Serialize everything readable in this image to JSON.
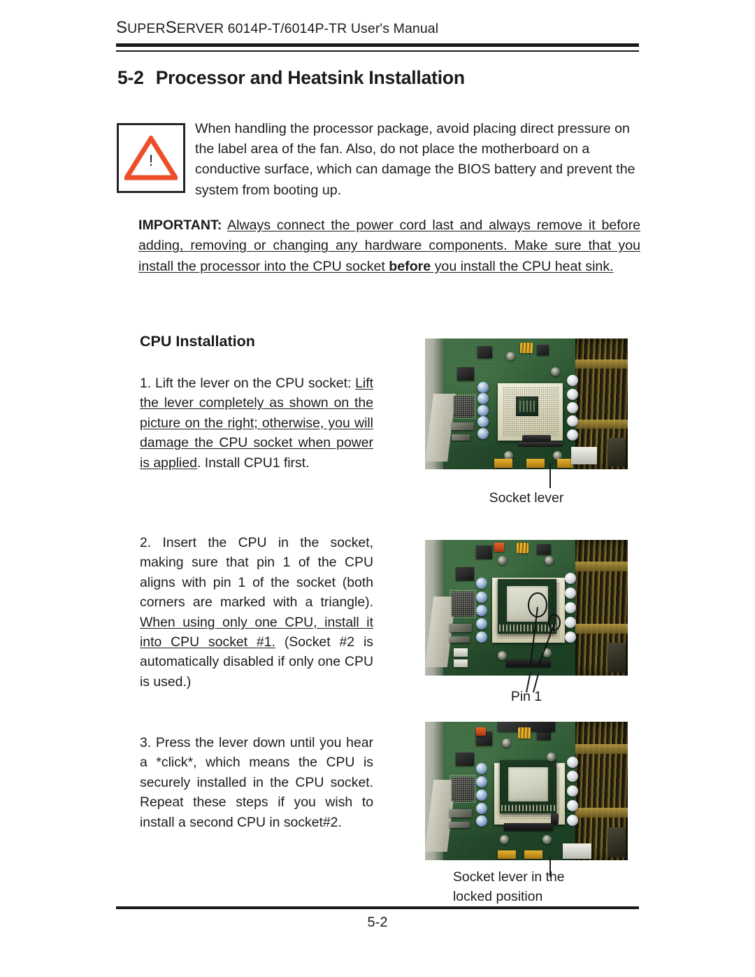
{
  "header": {
    "running_head_prefix": "S",
    "running_head": "SUPERSERVER 6014P-T/6014P-TR User's Manual",
    "running_head_parts": {
      "s1": "S",
      "uper": "UPER",
      "s2": "S",
      "erver": "ERVER",
      "rest": " 6014P-T/6014P-TR User's Manual"
    }
  },
  "section": {
    "number": "5-2",
    "title": "Processor and Heatsink Installation"
  },
  "warning": {
    "icon": "warning-triangle-icon",
    "bang": "!",
    "triangle_color": "#ED4E2A",
    "text": "When handling the processor package, avoid placing direct pressure on the label area of the fan.  Also, do not place the motherboard on a conductive surface, which can damage the BIOS battery and prevent the system from booting up."
  },
  "important": {
    "label": "IMPORTANT:",
    "underlined_text": "Always connect the power cord last and always remove it before adding, removing or changing any hardware components.  Make sure that you install the processor into the CPU socket ",
    "bold_word": "before",
    "tail_text": " you install the CPU heat sink."
  },
  "subsection": {
    "heading": "CPU Installation"
  },
  "steps": [
    {
      "number": "1.",
      "plain_lead": "1. Lift the lever on the CPU socket: ",
      "underlined": "Lift the lever completely as shown on the picture on the right; otherwise,  you will damage the CPU socket when power is applied",
      "tail": ".  Install CPU1 first."
    },
    {
      "number": "2.",
      "plain_lead": "2. Insert the CPU in the socket, making sure that pin 1 of the CPU aligns with pin 1 of the socket (both corners are marked with a triangle). ",
      "underlined": "When using only one CPU, install it into CPU socket #1.",
      "tail": "  (Socket #2 is automatically disabled if only one CPU is used.)"
    },
    {
      "number": "3.",
      "plain_lead": "3. Press the lever down until you hear a *click*, which means the CPU is securely installed in the CPU socket.  Repeat these steps if you wish to install a second CPU in socket#2.",
      "underlined": "",
      "tail": ""
    }
  ],
  "figures": [
    {
      "name": "cpu-socket-lever-open-photo",
      "alt": "Motherboard photo showing the open CPU socket",
      "caption": "Socket lever"
    },
    {
      "name": "cpu-inserted-pin1-photo",
      "alt": "Motherboard photo showing CPU inserted with pin 1 corners circled",
      "caption": "Pin 1"
    },
    {
      "name": "socket-lever-locked-photo",
      "alt": "Motherboard photo showing the socket lever in the locked position",
      "caption_line1": "Socket lever in the",
      "caption_line2": "locked position"
    }
  ],
  "footer": {
    "page_number": "5-2"
  }
}
